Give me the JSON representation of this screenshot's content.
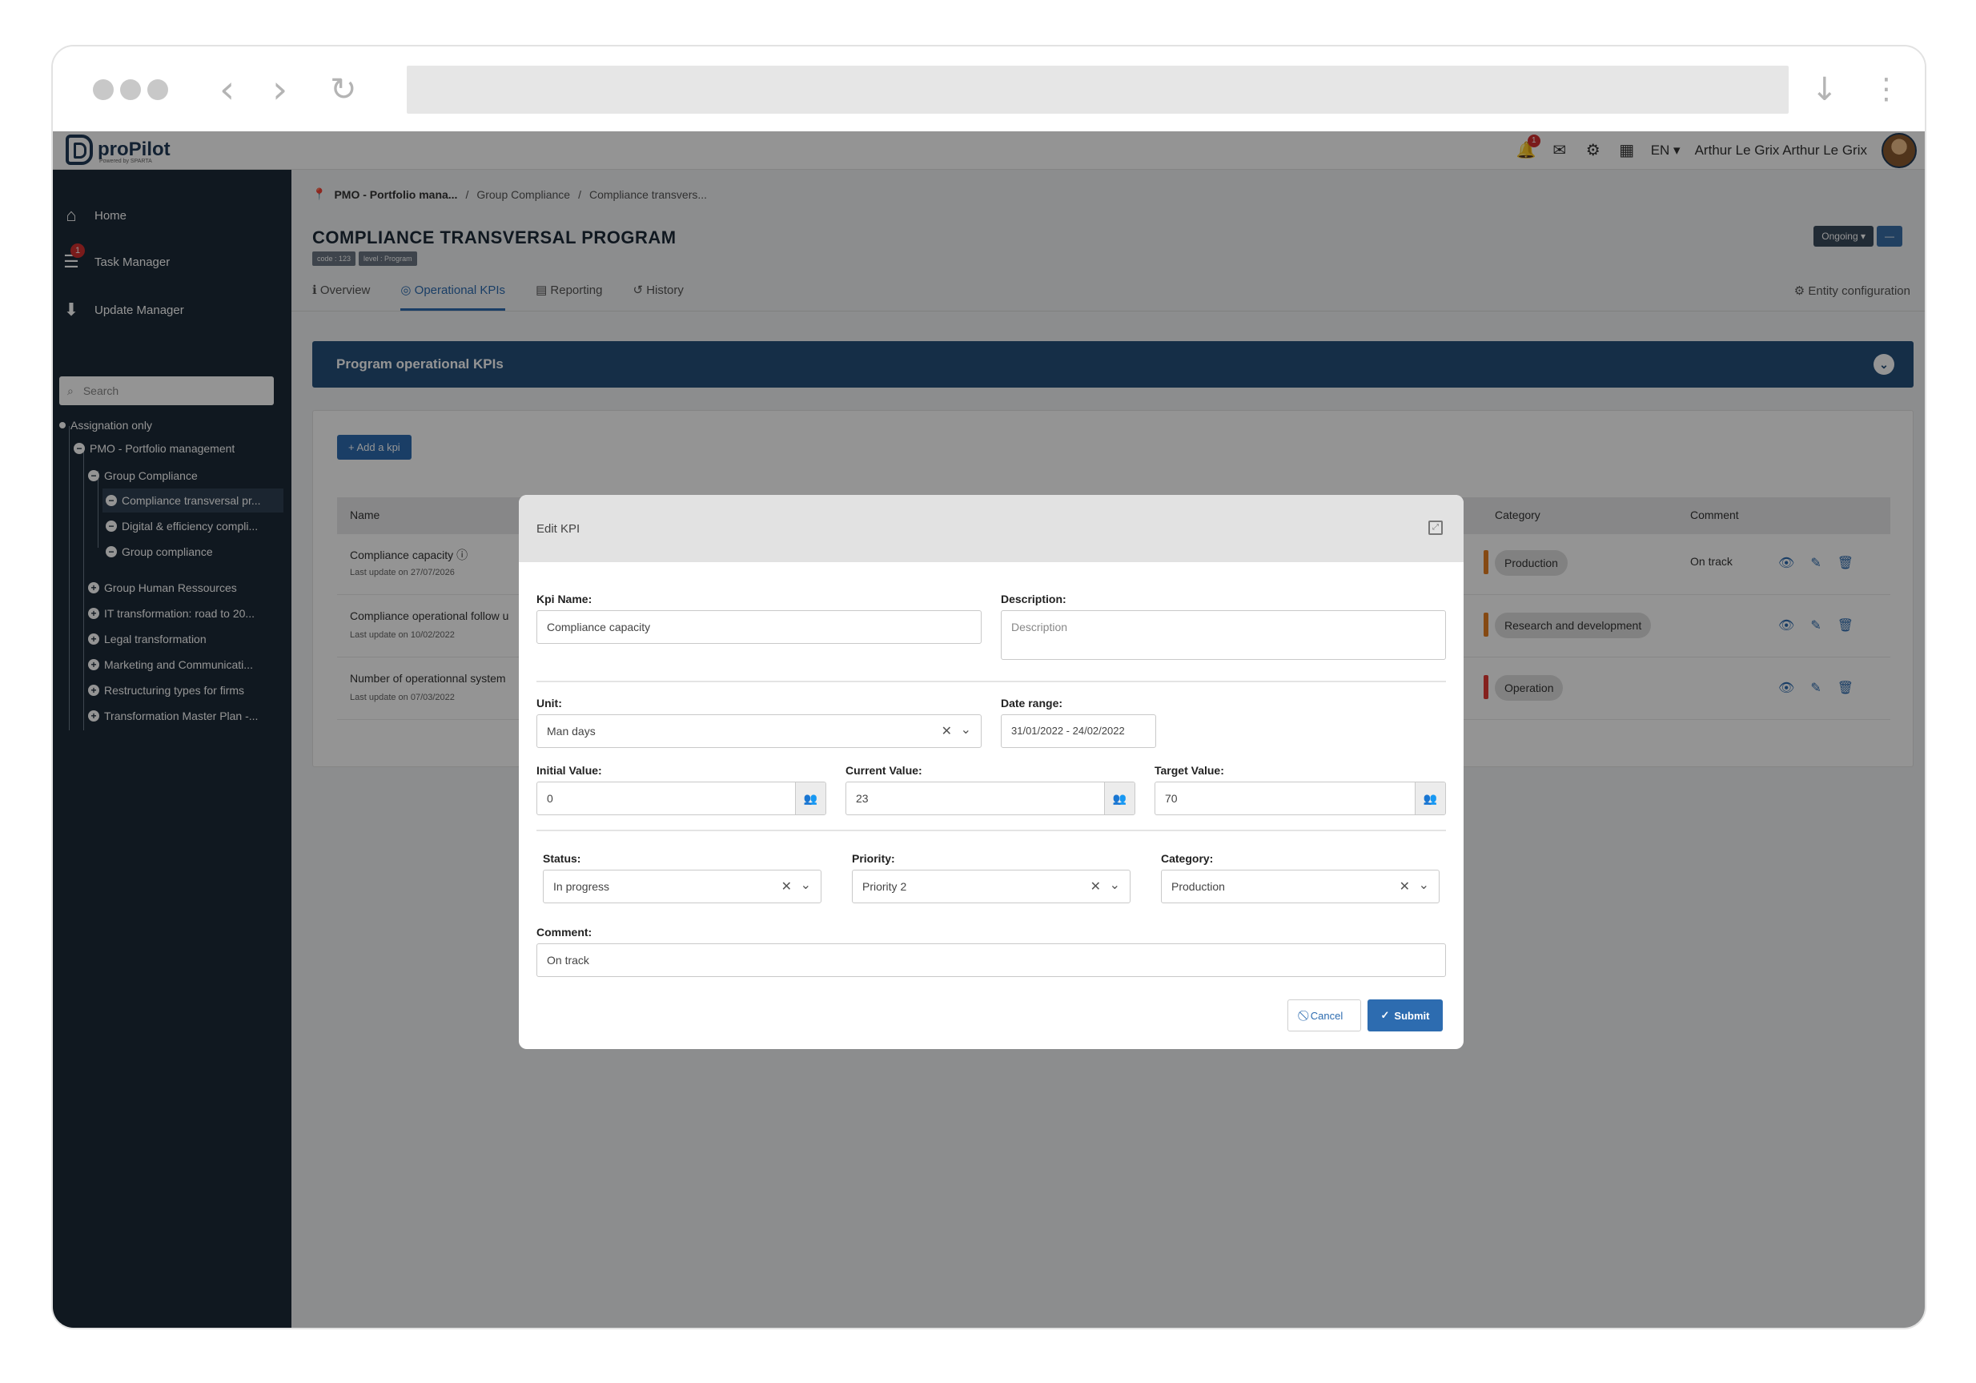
{
  "topbar": {
    "logo_text": "proPilot",
    "logo_sub": "Powered by SPARTA",
    "notif_count": "1",
    "lang": "EN ▾",
    "user": "Arthur Le Grix Arthur Le Grix"
  },
  "sidebar": {
    "nav": [
      {
        "label": "Home",
        "icon": "home-icon"
      },
      {
        "label": "Task Manager",
        "icon": "task-list-icon",
        "badge": "1"
      },
      {
        "label": "Update Manager",
        "icon": "download-icon"
      }
    ],
    "search_placeholder": "Search",
    "tree": [
      {
        "label": "Assignation only"
      },
      {
        "label": "PMO - Portfolio management"
      },
      {
        "label": "Group Compliance"
      },
      {
        "label": "Compliance transversal pr..."
      },
      {
        "label": "Digital & efficiency compli..."
      },
      {
        "label": "Group compliance"
      },
      {
        "label": "Group Human Ressources"
      },
      {
        "label": "IT transformation: road to 20..."
      },
      {
        "label": "Legal transformation"
      },
      {
        "label": "Marketing and Communicati..."
      },
      {
        "label": "Restructuring types for firms"
      },
      {
        "label": "Transformation Master Plan -..."
      }
    ]
  },
  "breadcrumb": [
    "PMO - Portfolio mana...",
    "/",
    "Group Compliance",
    "/",
    "Compliance transvers..."
  ],
  "program": {
    "title": "COMPLIANCE TRANSVERSAL PROGRAM",
    "tags": [
      "code : 123",
      "level : Program"
    ],
    "status_button": "Ongoing ▾",
    "collapse_button": "—"
  },
  "tabs": [
    "Overview",
    "Operational KPIs",
    "Reporting",
    "History"
  ],
  "entity_config": "Entity configuration",
  "kpi_section": {
    "title": "Program operational KPIs",
    "add_button": "+ Add a kpi",
    "columns": {
      "name": "Name",
      "category": "Category",
      "comment": "Comment"
    },
    "rows": [
      {
        "name": "Compliance capacity",
        "updated": "Last update on 27/07/2026",
        "category": "Production",
        "comment": "On track",
        "stripe": "#e67e22"
      },
      {
        "name": "Compliance operational follow u",
        "updated": "Last update on 10/02/2022",
        "category": "Research and development",
        "comment": "",
        "stripe": "#e67e22"
      },
      {
        "name": "Number of operationnal system",
        "updated": "Last update on 07/03/2022",
        "category": "Operation",
        "comment": "",
        "stripe": "#e53935"
      }
    ]
  },
  "modal": {
    "title": "Edit KPI",
    "kpi_name_label": "Kpi Name:",
    "kpi_name_value": "Compliance capacity",
    "description_label": "Description:",
    "description_placeholder": "Description",
    "unit_label": "Unit:",
    "unit_value": "Man days",
    "date_range_label": "Date range:",
    "date_range_value": "31/01/2022 - 24/02/2022",
    "initial_label": "Initial Value:",
    "initial_value": "0",
    "current_label": "Current Value:",
    "current_value": "23",
    "target_label": "Target Value:",
    "target_value": "70",
    "status_label": "Status:",
    "status_value": "In progress",
    "priority_label": "Priority:",
    "priority_value": "Priority 2",
    "category_label": "Category:",
    "category_value": "Production",
    "comment_label": "Comment:",
    "comment_value": "On track",
    "cancel_label": "Cancel",
    "submit_label": "Submit"
  }
}
